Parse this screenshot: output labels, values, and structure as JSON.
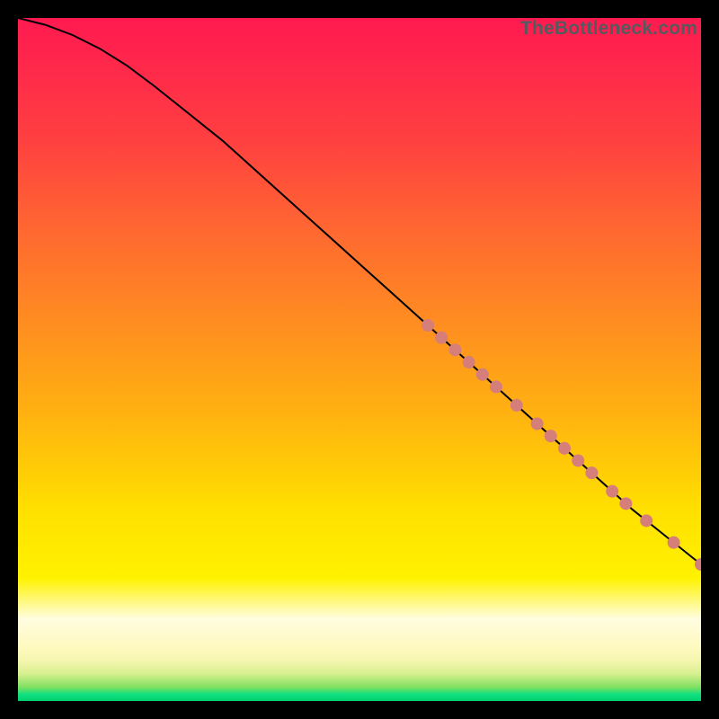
{
  "attribution": "TheBottleneck.com",
  "colors": {
    "curve": "#000000",
    "dot_fill": "#d57e7a",
    "bg_top": "#ff1a50",
    "bg_mid": "#ffe000",
    "bg_bottom": "#00d070"
  },
  "chart_data": {
    "type": "line",
    "title": "",
    "xlabel": "",
    "ylabel": "",
    "xlim": [
      0,
      100
    ],
    "ylim": [
      0,
      100
    ],
    "grid": false,
    "legend": false,
    "x": [
      0,
      4,
      8,
      12,
      16,
      20,
      25,
      30,
      35,
      40,
      45,
      50,
      55,
      60,
      65,
      70,
      75,
      80,
      85,
      90,
      95,
      100
    ],
    "y": [
      100,
      99,
      97.5,
      95.5,
      93,
      90,
      86,
      82,
      77.5,
      73,
      68.5,
      64,
      59.5,
      55,
      50.5,
      46,
      41.5,
      37,
      32.5,
      28,
      24,
      20
    ],
    "highlight_points": [
      {
        "x": 60,
        "y": 55
      },
      {
        "x": 62,
        "y": 53.2
      },
      {
        "x": 64,
        "y": 51.4
      },
      {
        "x": 66,
        "y": 49.6
      },
      {
        "x": 68,
        "y": 47.8
      },
      {
        "x": 70,
        "y": 46
      },
      {
        "x": 73,
        "y": 43.3
      },
      {
        "x": 76,
        "y": 40.6
      },
      {
        "x": 78,
        "y": 38.8
      },
      {
        "x": 80,
        "y": 37
      },
      {
        "x": 82,
        "y": 35.2
      },
      {
        "x": 84,
        "y": 33.4
      },
      {
        "x": 87,
        "y": 30.7
      },
      {
        "x": 89,
        "y": 28.9
      },
      {
        "x": 92,
        "y": 26.4
      },
      {
        "x": 96,
        "y": 23.2
      },
      {
        "x": 100,
        "y": 20
      }
    ],
    "dot_radius": 7
  }
}
